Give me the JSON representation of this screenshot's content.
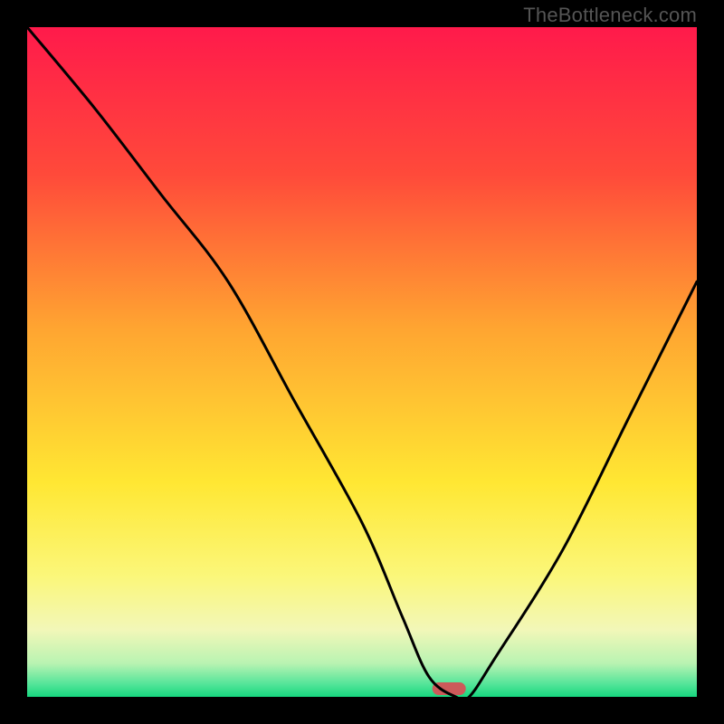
{
  "watermark": "TheBottleneck.com",
  "chart_data": {
    "type": "line",
    "title": "",
    "xlabel": "",
    "ylabel": "",
    "xlim": [
      0,
      100
    ],
    "ylim": [
      0,
      100
    ],
    "grid": false,
    "legend": false,
    "gradient_stops": [
      {
        "offset": 0,
        "color": "#ff1a4b"
      },
      {
        "offset": 22,
        "color": "#ff4a3a"
      },
      {
        "offset": 45,
        "color": "#ffa531"
      },
      {
        "offset": 68,
        "color": "#ffe733"
      },
      {
        "offset": 82,
        "color": "#fbf77a"
      },
      {
        "offset": 90,
        "color": "#f2f7b8"
      },
      {
        "offset": 95,
        "color": "#b9f3b2"
      },
      {
        "offset": 98,
        "color": "#57e59a"
      },
      {
        "offset": 100,
        "color": "#17d77f"
      }
    ],
    "series": [
      {
        "name": "bottleneck-curve",
        "x": [
          0,
          10,
          20,
          30,
          40,
          50,
          56,
          60,
          64,
          66,
          70,
          80,
          90,
          100
        ],
        "y": [
          100,
          88,
          75,
          62,
          44,
          26,
          12,
          3,
          0,
          0,
          6,
          22,
          42,
          62
        ]
      }
    ],
    "marker": {
      "name": "optimal-marker",
      "x": 63,
      "y": 0,
      "width_pct": 5,
      "color": "#cc5a5a"
    }
  }
}
